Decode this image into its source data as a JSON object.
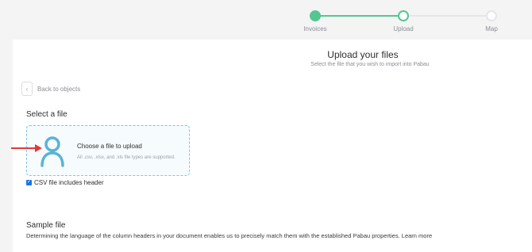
{
  "stepper": {
    "steps": [
      {
        "label": "Invoices",
        "state": "complete"
      },
      {
        "label": "Upload",
        "state": "current"
      },
      {
        "label": "Map",
        "state": "pending"
      }
    ]
  },
  "header": {
    "title": "Upload your files",
    "subtitle": "Select the file that you wish to import into Pabau"
  },
  "back": {
    "label": "Back to objects",
    "icon": "chevron-left-icon"
  },
  "select_file": {
    "title": "Select a file",
    "dropzone_title": "Choose a file to upload",
    "dropzone_subtitle": "All .csv, .xlsx, and .xls file types are supported.",
    "icon": "user-icon",
    "icon_color": "#5bb3d6"
  },
  "csv_header": {
    "label": "CSV file includes header",
    "checked": true
  },
  "sample": {
    "title": "Sample file",
    "description": "Determining the language of the column headers in your document enables us to precisely match them with the established Pabau properties. Learn more"
  },
  "colors": {
    "accent_green": "#54c692",
    "annotation_arrow": "#e53935",
    "checkbox_blue": "#1a73e8"
  }
}
